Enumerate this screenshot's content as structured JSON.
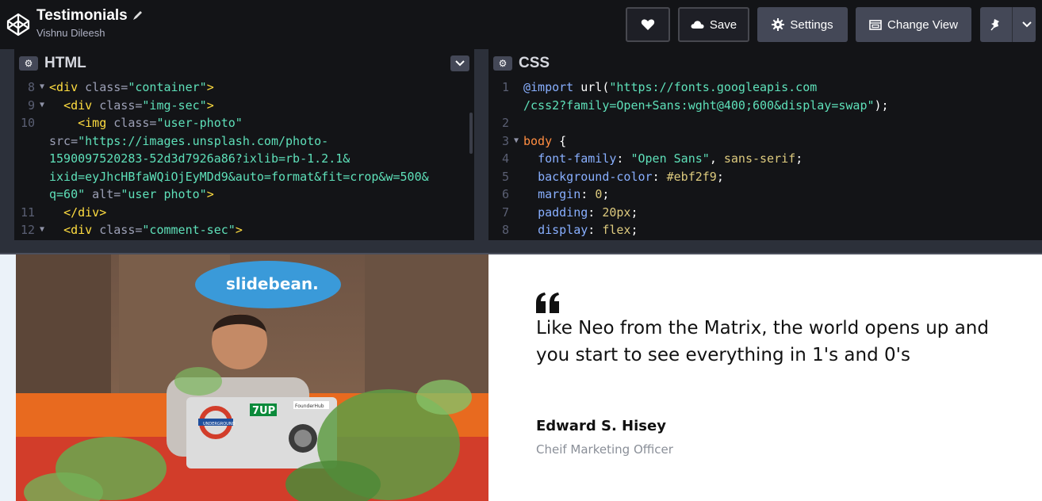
{
  "header": {
    "title": "Testimonials",
    "author": "Vishnu Dileesh",
    "buttons": {
      "save_label": "Save",
      "settings_label": "Settings",
      "change_view_label": "Change View"
    }
  },
  "editors": {
    "html": {
      "label": "HTML",
      "lines": [
        {
          "n": "8",
          "fold": true
        },
        {
          "n": "9",
          "fold": true
        },
        {
          "n": "10",
          "fold": false
        },
        {
          "n": "",
          "fold": false
        },
        {
          "n": "",
          "fold": false
        },
        {
          "n": "",
          "fold": false
        },
        {
          "n": "",
          "fold": false
        },
        {
          "n": "11",
          "fold": false
        },
        {
          "n": "12",
          "fold": true
        }
      ],
      "tokens": {
        "l8_open": "<div",
        "l8_attr": " class=",
        "l8_str": "\"container\"",
        "l8_close": ">",
        "l9_open": "<div",
        "l9_attr": " class=",
        "l9_str": "\"img-sec\"",
        "l9_close": ">",
        "l10_open": "<img",
        "l10_attr": " class=",
        "l10_str": "\"user-photo\"",
        "l10b_attr": "src=",
        "l10b_str": "\"https://images.unsplash.com/photo-",
        "l10c_str": "1590097520283-52d3d7926a86?ixlib=rb-1.2.1&",
        "l10d_str": "ixid=eyJhcHBfaWQiOjEyMDd9&auto=format&fit=crop&w=500&",
        "l10e_str": "q=60\"",
        "l10e_attr": " alt=",
        "l10e_str2": "\"user photo\"",
        "l10e_close": ">",
        "l11_close": "</div>",
        "l12_open": "<div",
        "l12_attr": " class=",
        "l12_str": "\"comment-sec\"",
        "l12_close": ">"
      }
    },
    "css": {
      "label": "CSS",
      "tokens": {
        "l1_at": "@import",
        "l1_fn": " url(",
        "l1_str": "\"https://fonts.googleapis.com",
        "l1b_str": "/css2?family=Open+Sans:wght@400;600&display=swap\"",
        "l1b_end": ");",
        "l3_sel": "body",
        "l3_brace": " {",
        "l4_prop": "font-family",
        "l4_str": "\"Open Sans\"",
        "l4_kw": "sans-serif",
        "l5_prop": "background-color",
        "l5_val": "#ebf2f9",
        "l6_prop": "margin",
        "l6_val": "0",
        "l7_prop": "padding",
        "l7_val": "20px",
        "l8_prop": "display",
        "l8_val": "flex"
      }
    }
  },
  "preview": {
    "photo": {
      "sign_text": "slidebean.",
      "stickers": [
        "7UP",
        "UNDERGROUND",
        "FounderHub"
      ]
    },
    "quote": "Like Neo from the Matrix, the world opens up and you start to see everything in 1's and 0's",
    "name": "Edward S. Hisey",
    "role": "Cheif Marketing Officer",
    "background": "#ebf2f9"
  },
  "icons": [
    "codepen-logo-icon",
    "pencil-icon",
    "heart-icon",
    "cloud-icon",
    "gear-icon",
    "change-view-icon",
    "pin-icon",
    "chevron-down-icon",
    "quote-icon"
  ]
}
